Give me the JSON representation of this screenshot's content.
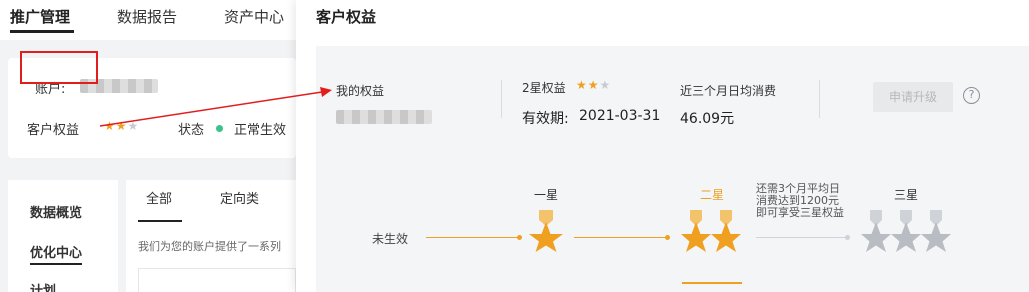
{
  "left": {
    "nav_tabs": [
      "推广管理",
      "数据报告",
      "资产中心"
    ],
    "account_label": "账户:",
    "rights_label": "客户权益",
    "rights_stars": 2,
    "rights_stars_max": 3,
    "status_label": "状态",
    "status_value": "正常生效",
    "menu": [
      "数据概览",
      "优化中心",
      "计划"
    ],
    "content_tabs": [
      "全部",
      "定向类"
    ],
    "content_desc": "我们为您的账户提供了一系列"
  },
  "panel": {
    "title": "客户权益",
    "my_rights_label": "我的权益",
    "star_level_label": "2星权益",
    "star_level_stars": 2,
    "valid_label": "有效期:",
    "valid_date": "2021-03-31",
    "spend_label": "近三个月日均消费",
    "spend_value": "46.09元",
    "upgrade_button": "申请升级",
    "help_glyph": "?"
  },
  "levels": {
    "inactive_label": "未生效",
    "one_star": "一星",
    "two_star": "二星",
    "three_star": "三星",
    "upgrade_hint": [
      "还需3个月平均日",
      "消费达到1200元",
      "即可享受三星权益"
    ]
  },
  "colors": {
    "accent": "#f0a020",
    "highlight_box": "#e01e1e",
    "status_green": "#3ac48b"
  },
  "icons": [
    "star-icon",
    "help-icon",
    "medal-icon",
    "arrow-annotation"
  ]
}
